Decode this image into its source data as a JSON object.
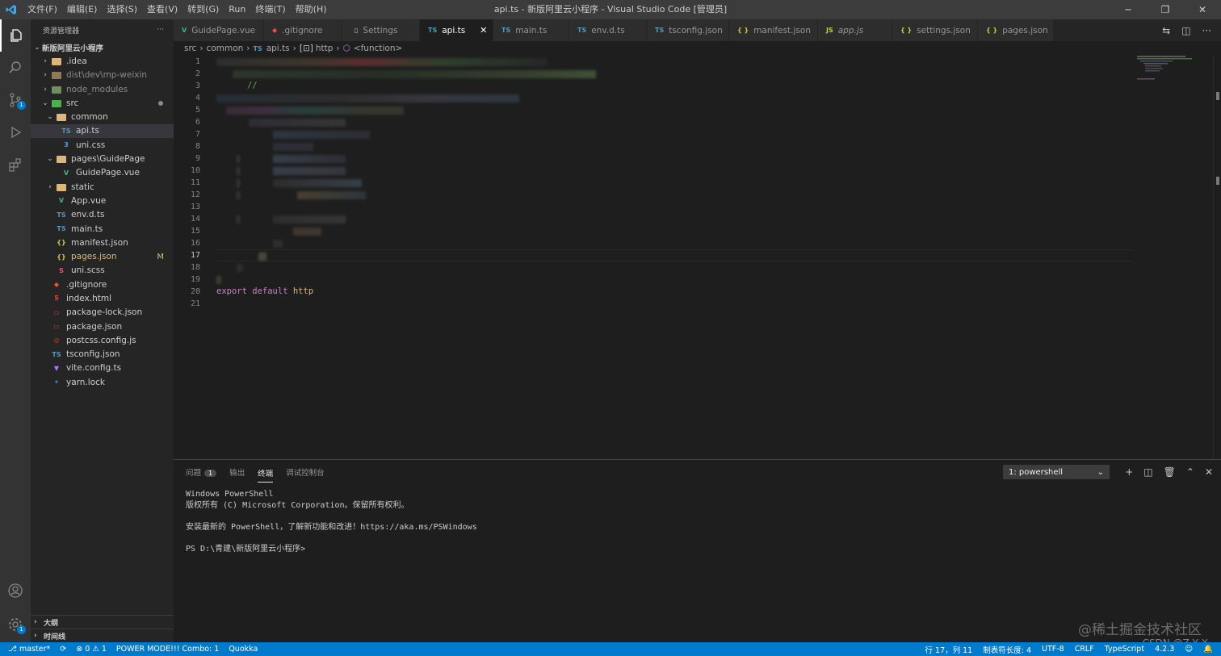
{
  "window": {
    "title": "api.ts - 新版阿里云小程序 - Visual Studio Code [管理员]",
    "menus": [
      "文件(F)",
      "编辑(E)",
      "选择(S)",
      "查看(V)",
      "转到(G)",
      "Run",
      "终端(T)",
      "帮助(H)"
    ]
  },
  "activity": {
    "scm_badge": "1",
    "settings_badge": "1"
  },
  "sidebar": {
    "header": "资源管理器",
    "more": "···",
    "root": "新版阿里云小程序",
    "items": [
      {
        "label": ".idea",
        "icon": "folder-icon",
        "dim": false
      },
      {
        "label": "dist\\dev\\mp-weixin",
        "icon": "folder-icon",
        "dim": true
      },
      {
        "label": "node_modules",
        "icon": "folder-icon",
        "dim": true
      },
      {
        "label": "src",
        "icon": "folder-icon",
        "dim": false
      },
      {
        "label": "common",
        "icon": "folder-open-icon",
        "dim": false
      },
      {
        "label": "api.ts",
        "icon": "typescript-icon",
        "glyph": "TS"
      },
      {
        "label": "uni.css",
        "icon": "css-icon",
        "glyph": "3"
      },
      {
        "label": "pages\\GuidePage",
        "icon": "folder-open-icon"
      },
      {
        "label": "GuidePage.vue",
        "icon": "vue-icon",
        "glyph": "V"
      },
      {
        "label": "static",
        "icon": "folder-icon"
      },
      {
        "label": "App.vue",
        "icon": "vue-icon",
        "glyph": "V"
      },
      {
        "label": "env.d.ts",
        "icon": "typescript-icon",
        "glyph": "TS"
      },
      {
        "label": "main.ts",
        "icon": "typescript-icon",
        "glyph": "TS"
      },
      {
        "label": "manifest.json",
        "icon": "json-icon",
        "glyph": "{}"
      },
      {
        "label": "pages.json",
        "icon": "json-icon",
        "glyph": "{}",
        "status": "M"
      },
      {
        "label": "uni.scss",
        "icon": "sass-icon",
        "glyph": "S"
      },
      {
        "label": ".gitignore",
        "icon": "git-icon",
        "glyph": "◆"
      },
      {
        "label": "index.html",
        "icon": "html-icon",
        "glyph": "5"
      },
      {
        "label": "package-lock.json",
        "icon": "npm-icon",
        "glyph": "▭"
      },
      {
        "label": "package.json",
        "icon": "npm-icon",
        "glyph": "▭"
      },
      {
        "label": "postcss.config.js",
        "icon": "postcss-icon",
        "glyph": "◎"
      },
      {
        "label": "tsconfig.json",
        "icon": "tsconfig-icon",
        "glyph": "TS"
      },
      {
        "label": "vite.config.ts",
        "icon": "vite-icon",
        "glyph": "▼"
      },
      {
        "label": "yarn.lock",
        "icon": "yarn-icon",
        "glyph": "✦"
      }
    ],
    "outline": "大纲",
    "timeline": "时间线"
  },
  "tabs": [
    {
      "label": "GuidePage.vue",
      "glyph": "V",
      "color": "#41b883"
    },
    {
      "label": ".gitignore",
      "glyph": "◆",
      "color": "#f14e32"
    },
    {
      "label": "Settings",
      "glyph": "▯",
      "color": "#cccccc"
    },
    {
      "label": "api.ts",
      "glyph": "TS",
      "color": "#519aba",
      "active": true
    },
    {
      "label": "main.ts",
      "glyph": "TS",
      "color": "#519aba"
    },
    {
      "label": "env.d.ts",
      "glyph": "TS",
      "color": "#519aba"
    },
    {
      "label": "tsconfig.json",
      "glyph": "TS",
      "color": "#519aba"
    },
    {
      "label": "manifest.json",
      "glyph": "{ }",
      "color": "#cbcb41"
    },
    {
      "label": "app.js",
      "glyph": "JS",
      "color": "#cbcb41"
    },
    {
      "label": "settings.json",
      "glyph": "{ }",
      "color": "#cbcb41"
    },
    {
      "label": "pages.json",
      "glyph": "{ }",
      "color": "#cbcb41"
    }
  ],
  "breadcrumb": [
    "src",
    "common",
    "api.ts",
    "http",
    "<function>"
  ],
  "editor": {
    "line_numbers": [
      "1",
      "2",
      "3",
      "4",
      "5",
      "6",
      "7",
      "8",
      "9",
      "10",
      "11",
      "12",
      "13",
      "14",
      "15",
      "16",
      "17",
      "18",
      "19",
      "20",
      "21"
    ],
    "current_line": "17",
    "comment": "//",
    "export_kw": "export",
    "default_kw": "default",
    "export_id": "http"
  },
  "panel": {
    "tabs": [
      "问题",
      "输出",
      "终端",
      "调试控制台"
    ],
    "problems_count": "1",
    "terminal_select": "1: powershell",
    "terminal_lines": [
      "Windows PowerShell",
      "版权所有 (C) Microsoft Corporation。保留所有权利。",
      "",
      "安装最新的 PowerShell，了解新功能和改进！https://aka.ms/PSWindows",
      "",
      "PS D:\\青建\\新版阿里云小程序>"
    ]
  },
  "statusbar": {
    "branch": "master*",
    "errors": "0",
    "warnings": "1",
    "power_mode": "POWER MODE!!! Combo: 1",
    "quokka": "Quokka",
    "position": "行 17，列 11",
    "tab_size": "制表符长度: 4",
    "encoding": "UTF-8",
    "eol": "CRLF",
    "language": "TypeScript",
    "version": "4.2.3"
  },
  "watermark": "@稀土掘金技术社区",
  "watermark2": "CSDN @Z Y X"
}
